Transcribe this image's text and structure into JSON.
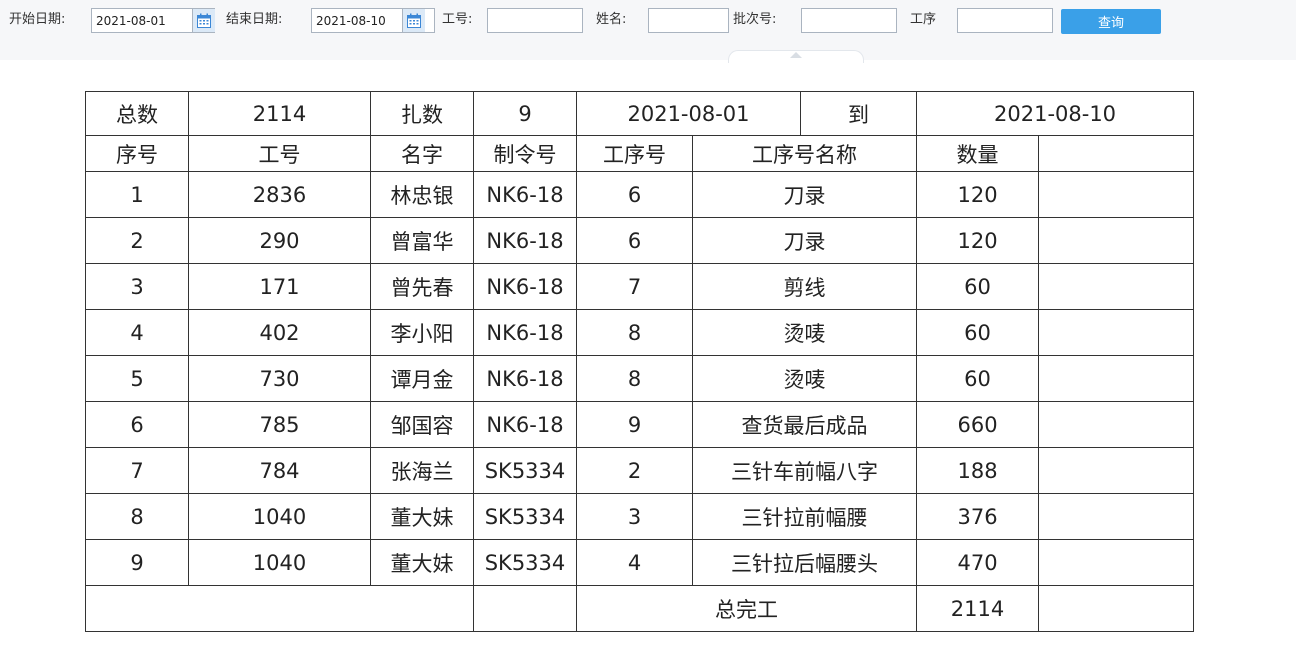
{
  "filters": {
    "start_date_label": "开始日期:",
    "start_date_value": "2021-08-01",
    "end_date_label": "结束日期:",
    "end_date_value": "2021-08-10",
    "emp_no_label": "工号:",
    "emp_no_value": "",
    "name_label": "姓名:",
    "name_value": "",
    "batch_label": "批次号:",
    "batch_value": "",
    "process_label": "工序",
    "process_value": "",
    "query_button": "查询"
  },
  "summary": {
    "total_label": "总数",
    "total_value": "2114",
    "bundle_label": "扎数",
    "bundle_value": "9",
    "date_from": "2021-08-01",
    "to_label": "到",
    "date_to": "2021-08-10"
  },
  "columns": [
    "序号",
    "工号",
    "名字",
    "制令号",
    "工序号",
    "工序号名称",
    "数量"
  ],
  "rows": [
    {
      "seq": "1",
      "emp_no": "2836",
      "name": "林忠银",
      "order": "NK6-18",
      "step": "6",
      "step_name": "刀录",
      "qty": "120"
    },
    {
      "seq": "2",
      "emp_no": "290",
      "name": "曾富华",
      "order": "NK6-18",
      "step": "6",
      "step_name": "刀录",
      "qty": "120"
    },
    {
      "seq": "3",
      "emp_no": "171",
      "name": "曾先春",
      "order": "NK6-18",
      "step": "7",
      "step_name": "剪线",
      "qty": "60"
    },
    {
      "seq": "4",
      "emp_no": "402",
      "name": "李小阳",
      "order": "NK6-18",
      "step": "8",
      "step_name": "烫唛",
      "qty": "60"
    },
    {
      "seq": "5",
      "emp_no": "730",
      "name": "谭月金",
      "order": "NK6-18",
      "step": "8",
      "step_name": "烫唛",
      "qty": "60"
    },
    {
      "seq": "6",
      "emp_no": "785",
      "name": "邹国容",
      "order": "NK6-18",
      "step": "9",
      "step_name": "查货最后成品",
      "qty": "660"
    },
    {
      "seq": "7",
      "emp_no": "784",
      "name": "张海兰",
      "order": "SK5334",
      "step": "2",
      "step_name": "三针车前幅八字",
      "qty": "188"
    },
    {
      "seq": "8",
      "emp_no": "1040",
      "name": "董大妹",
      "order": "SK5334",
      "step": "3",
      "step_name": "三针拉前幅腰",
      "qty": "376"
    },
    {
      "seq": "9",
      "emp_no": "1040",
      "name": "董大妹",
      "order": "SK5334",
      "step": "4",
      "step_name": "三针拉后幅腰头",
      "qty": "470"
    }
  ],
  "footer": {
    "total_done_label": "总完工",
    "total_done_value": "2114"
  },
  "icons": {
    "calendar": "calendar-icon"
  },
  "colors": {
    "query_button": "#3aa0e8",
    "calendar_button": "#dbe9f7"
  }
}
